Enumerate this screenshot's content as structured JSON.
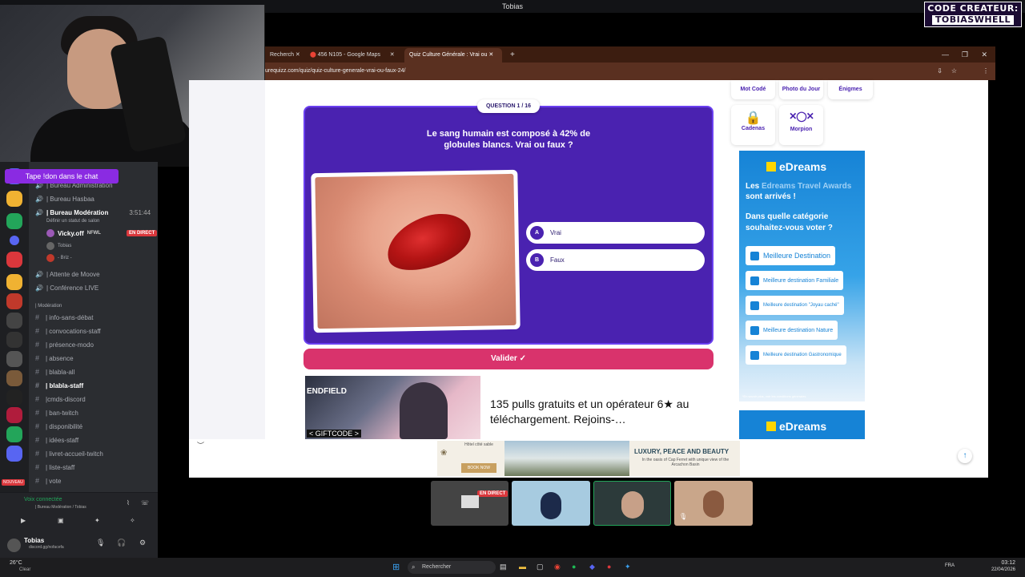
{
  "stream": {
    "title_window": "Tobias",
    "creator_code_label": "CODE CREATEUR:",
    "creator_code_name": "TOBIASWHELL",
    "chat_cta": "Tape !don dans le chat"
  },
  "discord": {
    "channels": [
      {
        "icon": "speaker-icon",
        "label": "| Bureau Administration",
        "bold": false
      },
      {
        "icon": "speaker-icon",
        "label": "| Bureau Hasbaa",
        "bold": false
      },
      {
        "icon": "speaker-icon",
        "label": "| Bureau Modération",
        "bold": true,
        "extra": "3:51:44"
      },
      {
        "icon": "",
        "label": "Définir un statut de salon",
        "bold": false
      },
      {
        "icon": "avatar",
        "label": "Vicky.off",
        "bold": true,
        "extra": "NFWL",
        "badge": "EN DIRECT"
      },
      {
        "icon": "avatar",
        "label": "Tobias",
        "bold": false
      },
      {
        "icon": "avatar",
        "label": "- Briz -",
        "bold": false
      },
      {
        "icon": "speaker-icon",
        "label": "| Attente de Moove",
        "bold": false
      },
      {
        "icon": "speaker-icon",
        "label": "| Conférence LIVE",
        "bold": false
      }
    ],
    "category": "| Modération",
    "text_channels": [
      "| info-sans-débat",
      "| convocations-staff",
      "| présence-modo",
      "| absence",
      "| blabla-all",
      "| blabla-staff",
      "|cmds-discord",
      "| ban-twitch",
      "| disponibilité",
      "| idées-staff",
      "| livret-accueil-twitch",
      "| liste-staff",
      "| vote"
    ],
    "voice_status": "Voix connectée",
    "voice_channel": "| Bureau Modération / Tobias",
    "user_name": "Tobias",
    "user_status": "discord.gg/nofacefa",
    "new_badge": "NOUVEAU"
  },
  "browser": {
    "tabs": [
      "Recherch",
      "456 N105 - Google Maps",
      "Quiz Culture Générale : Vrai ou"
    ],
    "new_tab": "+",
    "url": "urequizz.com/quiz/quiz-culture-generale-vrai-ou-faux-24/"
  },
  "quiz": {
    "badge": "QUESTION 1 / 16",
    "question": "Le sang humain est composé à 42% de globules blancs. Vrai ou faux ?",
    "answers": [
      {
        "letter": "A",
        "label": "Vrai"
      },
      {
        "letter": "B",
        "label": "Faux"
      }
    ],
    "submit": "Valider ✓"
  },
  "sidebar_widgets": {
    "row1": [
      "Mot Codé",
      "Photo du Jour",
      "Énigmes"
    ],
    "row2": [
      "Cadenas",
      "Morpion"
    ]
  },
  "edreams": {
    "logo": "eDreams",
    "headline_pre": "Les",
    "headline_hl": "Edreams Travel Awards",
    "headline_post": "sont arrivés !",
    "question": "Dans quelle catégorie souhaitez-vous voter ?",
    "options": [
      "Meilleure Destination",
      "Meilleure destination Familiale",
      "Meilleure destination \"Joyau caché\"",
      "Meilleure destination Nature",
      "Meilleure destination Gastronomique"
    ],
    "fineprint": "*En savoir plus, voir les conditions générales",
    "logo2": "eDreams"
  },
  "ad": {
    "game_text": "ENDFIELD",
    "giftcode": "< GIFTCODE >",
    "headline": "135 pulls gratuits et un opérateur 6★ au téléchargement. Rejoins-…"
  },
  "bottom_ad": {
    "hotel_name": "Hôtel côté sable",
    "book": "BOOK NOW",
    "tagline": "LUXURY, PEACE AND BEAUTY",
    "sub": "In the oasis of Cap Ferret with unique view of the Arcachon Basin"
  },
  "call": {
    "live_badge": "EN DIRECT"
  },
  "taskbar": {
    "weather_temp": "26°C",
    "weather_desc": "Clear",
    "search_placeholder": "Rechercher",
    "lang": "FRA",
    "time": "03:12",
    "date": "22/04/2026"
  },
  "colors": {
    "quiz_purple": "#4a22b0",
    "valider_pink": "#d9336c",
    "edreams_blue": "#1683d6"
  }
}
